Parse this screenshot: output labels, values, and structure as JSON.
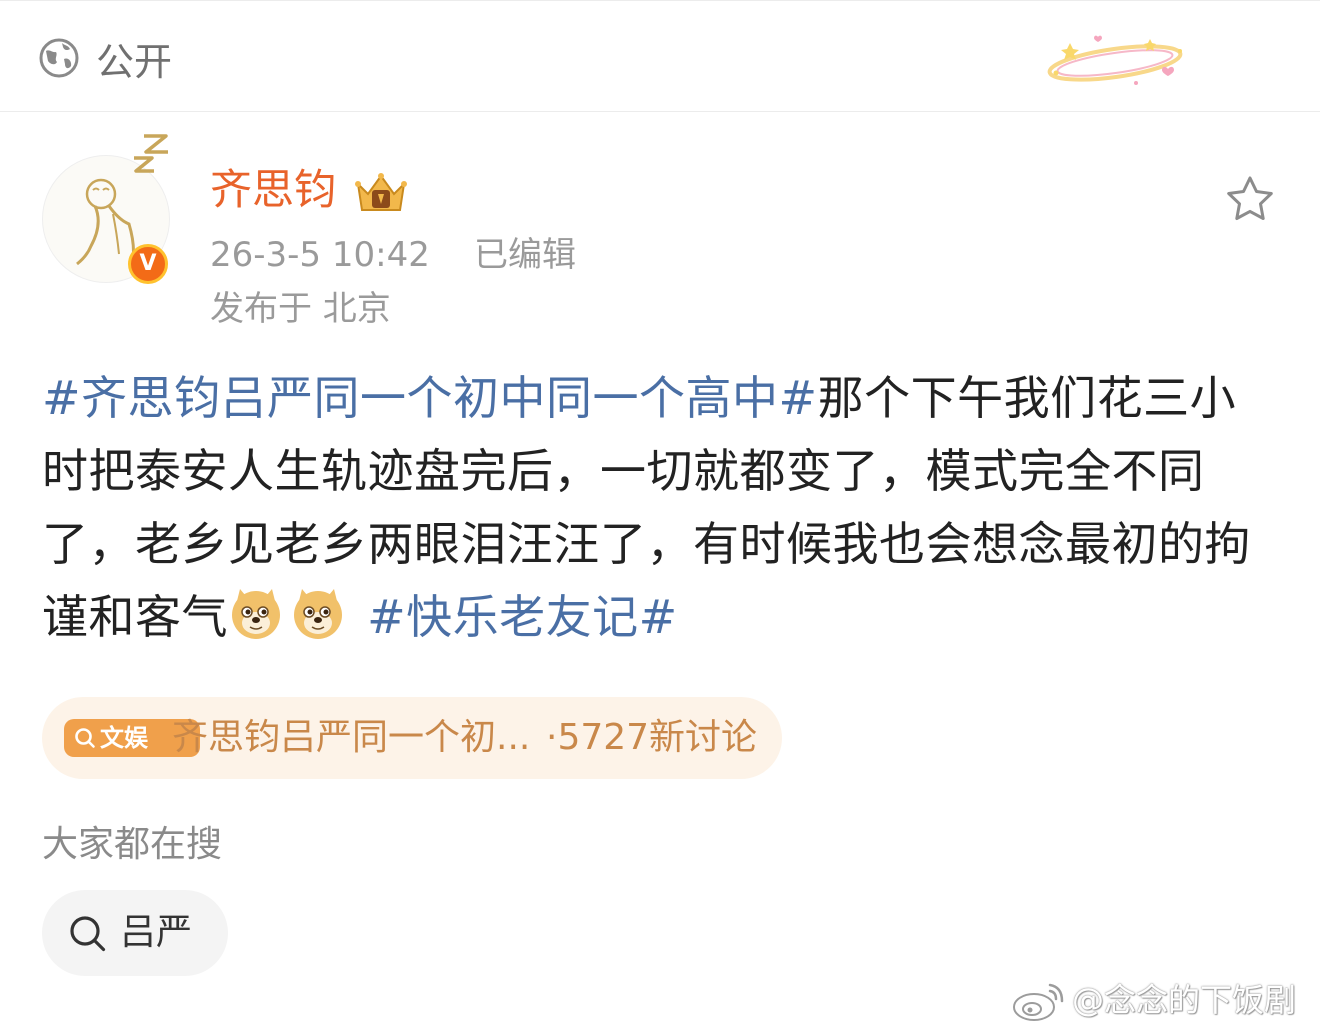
{
  "visibility": {
    "label": "公开",
    "icon": "globe-icon"
  },
  "post": {
    "author": {
      "name": "齐思钧",
      "verified_badge": "V",
      "crown_icon": "crown-badge-icon",
      "avatar": "sleeping-doodle-avatar"
    },
    "time": "26-3-5 10:42",
    "edited": "已编辑",
    "location": "发布于 北京",
    "favorite_icon": "star-icon",
    "body": {
      "tag1": "#齐思钧吕严同一个初中同一个高中#",
      "text": "那个下午我们花三小时把泰安人生轨迹盘完后，一切就都变了，模式完全不同了，老乡见老乡两眼泪汪汪了，有时候我也会想念最初的拘谨和客气",
      "emojis": [
        "doge-emoji",
        "doge-emoji"
      ],
      "tag2": "#快乐老友记#"
    }
  },
  "topic": {
    "badge_label": "文娱",
    "title": "齐思钧吕严同一个初...",
    "count": "·5727新讨论"
  },
  "search": {
    "heading": "大家都在搜",
    "chips": [
      {
        "label": "吕严"
      }
    ]
  },
  "watermark": {
    "text": "@念念的下饭剧"
  },
  "colors": {
    "username": "#e8632b",
    "hashtag": "#4a6fa5",
    "topic_text": "#c9884a",
    "topic_bg": "#fdf3e8",
    "topic_badge": "#f0a04b"
  }
}
